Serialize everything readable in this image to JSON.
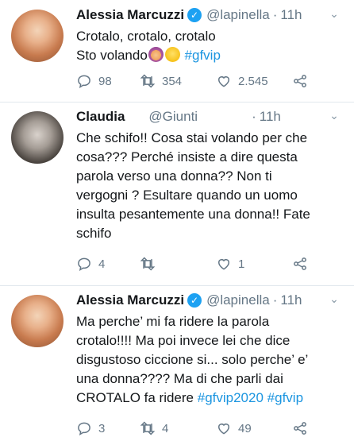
{
  "tweets": [
    {
      "name": "Alessia Marcuzzi",
      "verified": true,
      "handle": "@lapinella",
      "separator": "·",
      "time": "11h",
      "lines": [
        "Crotalo, crotalo, crotalo"
      ],
      "line2_prefix": "Sto volando",
      "hashtag": "#gfvip",
      "replies": "98",
      "retweets": "354",
      "likes": "2.545"
    },
    {
      "name": "Claudia",
      "handle": "@Giunti",
      "separator": "·",
      "time": "11h",
      "lines": [
        "Che schifo!! Cosa stai volando per che",
        "cosa??? Perché insiste a dire questa",
        "parola verso una donna?? Non ti",
        "vergogni ? Esultare quando un uomo",
        "insulta pesantemente una donna!! Fate",
        "schifo"
      ],
      "replies": "4",
      "retweets": "",
      "likes": "1"
    },
    {
      "name": "Alessia Marcuzzi",
      "verified": true,
      "handle": "@lapinella",
      "separator": "·",
      "time": "11h",
      "lines": [
        "Ma perche’ mi fa ridere la parola",
        "crotalo!!!! Ma poi invece lei che dice",
        "disgustoso ciccione si... solo perche’ e’",
        "una donna???? Ma di che parli dai"
      ],
      "last_prefix": "CROTALO fa ridere ",
      "hashtag_a": "#gfvip2020",
      "hashtag_b": "#gfvip",
      "replies": "3",
      "retweets": "4",
      "likes": "49"
    }
  ],
  "icons": {
    "reply": "reply-icon",
    "retweet": "retweet-icon",
    "like": "heart-icon",
    "share": "share-icon",
    "verified": "verified-badge-icon",
    "more": "chevron-down-icon"
  },
  "colors": {
    "hashtag": "#1b95e0",
    "verified": "#1da1f2",
    "secondary_text": "#657786",
    "divider": "#e1e8ed"
  }
}
